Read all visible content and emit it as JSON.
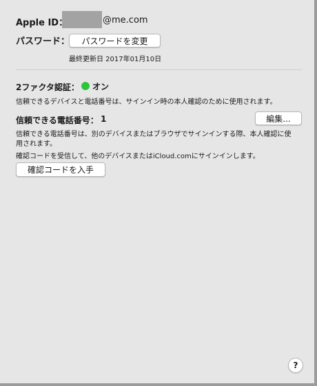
{
  "account": {
    "apple_id_label": "Apple ID：",
    "apple_id_domain": "@me.com",
    "password_label": "パスワード：",
    "change_password_button": "パスワードを変更",
    "last_updated": "最終更新日 2017年01月10日"
  },
  "two_factor": {
    "title": "2ファクタ認証：",
    "status": "オン",
    "status_color": "#2ec43b",
    "description": "信頼できるデバイスと電話番号は、サインイン時の本人確認のために使用されます。"
  },
  "trusted_numbers": {
    "title": "信頼できる電話番号：",
    "count": "1",
    "edit_button": "編集...",
    "description_line1": "信頼できる電話番号は、別のデバイスまたはブラウザでサインインする際、本人確認に使",
    "description_line2": "用されます。"
  },
  "verification": {
    "description": "確認コードを受信して、他のデバイスまたはiCloud.comにサインインします。",
    "get_code_button": "確認コードを入手"
  },
  "help": {
    "label": "?",
    "icon": "help-icon"
  }
}
